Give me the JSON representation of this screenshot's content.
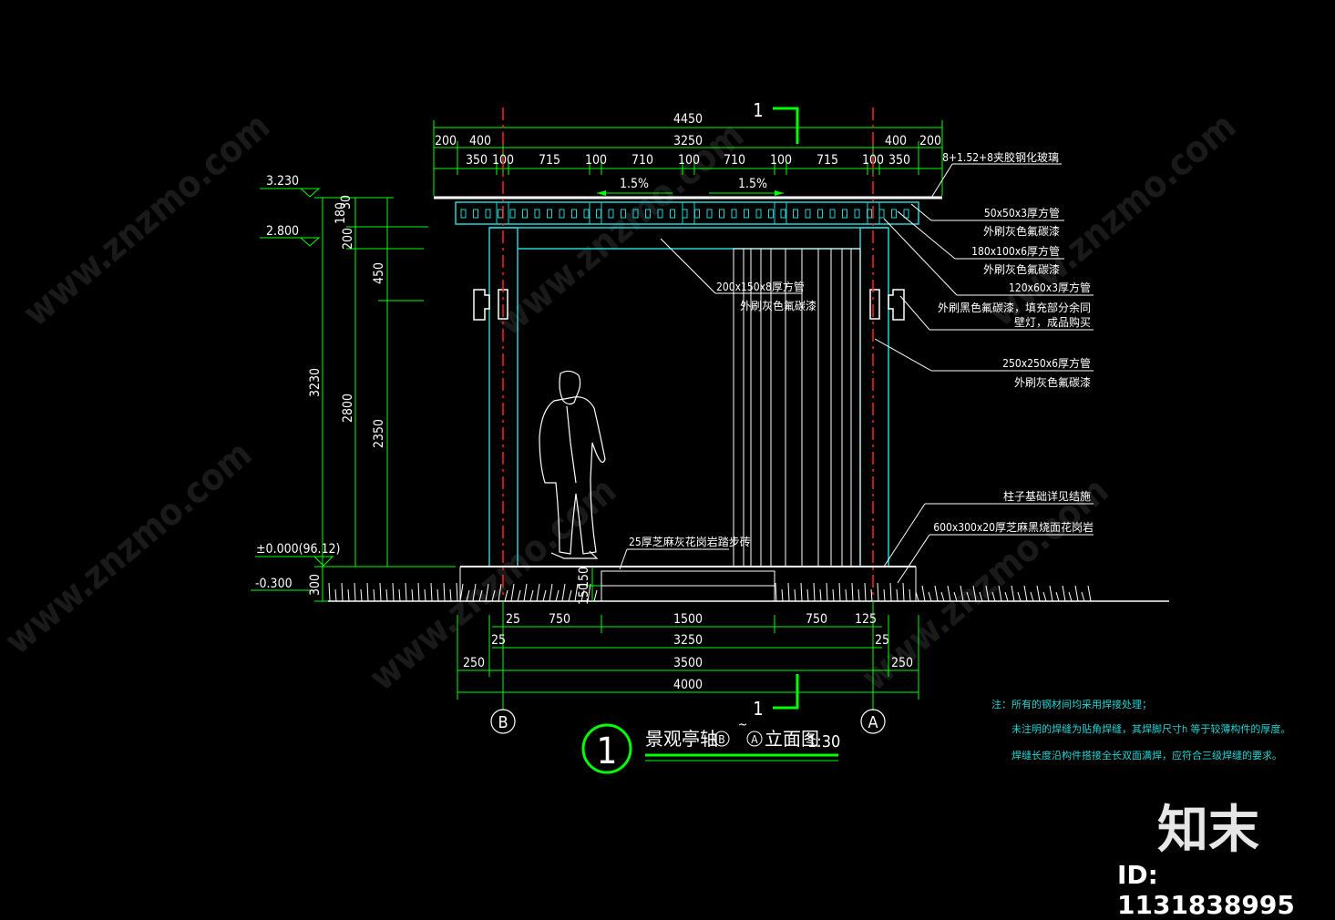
{
  "drawing": {
    "section_mark_top": "1",
    "section_mark_bottom": "1",
    "slope_left": "1.5%",
    "slope_right": "1.5%",
    "top_dims": {
      "overall": "4450",
      "row2": [
        "200",
        "400",
        "3250",
        "400",
        "200"
      ],
      "row3": [
        "350",
        "100",
        "715",
        "100",
        "710",
        "100",
        "710",
        "100",
        "715",
        "100",
        "350"
      ]
    },
    "levels": {
      "top": "3.230",
      "beam": "2.800",
      "ground": "±0.000(96.12)",
      "base": "-0.300"
    },
    "vert_dims": {
      "left_a": [
        "3230",
        "300"
      ],
      "left_b": "2800",
      "left_c": [
        "180",
        "30",
        "200",
        "450",
        "2350"
      ],
      "step": [
        "150",
        "150"
      ]
    },
    "bottom_dims": {
      "row1": [
        "25",
        "750",
        "1500",
        "750",
        "125"
      ],
      "row2": [
        "25",
        "3250",
        "25"
      ],
      "row3": [
        "250",
        "3500",
        "250"
      ],
      "row4": "4000"
    },
    "axes": {
      "left": "B",
      "right": "A"
    },
    "annotations": {
      "glass": "8+1.52+8夹胶钢化玻璃",
      "tube1_a": "50x50x3厚方管",
      "tube1_b": "外刷灰色氟碳漆",
      "tube2_a": "180x100x6厚方管",
      "tube2_b": "外刷灰色氟碳漆",
      "tube3_a": "120x60x3厚方管",
      "tube3_b": "外刷黑色氟碳漆，填充部分余同",
      "tube3_c": "壁灯，成品购买",
      "column_a": "250x250x6厚方管",
      "column_b": "外刷灰色氟碳漆",
      "beam_a": "200x150x8厚方管",
      "beam_b": "外刷灰色氟碳漆",
      "foundation": "柱子基础详见结施",
      "paving": "600x300x20厚芝麻黑烧面花岗岩",
      "step": "25厚芝麻灰花岗岩踏步砖"
    },
    "title": {
      "number": "1",
      "text_a": "景观亭轴",
      "axis_b": "B",
      "tilde": "~",
      "axis_a": "A",
      "text_b": "立面图",
      "scale": "1:30"
    },
    "notes": [
      "注：所有的钢材间均采用焊接处理；",
      "未注明的焊缝为贴角焊缝，其焊脚尺寸h 等于较薄构件的厚度。",
      "焊缝长度沿构件搭接全长双面满焊，应符合三级焊缝的要求。"
    ]
  },
  "watermark": {
    "text": "www.znzmo.com",
    "cn": "知末网",
    "brand": "知末",
    "id": "ID: 1131838995"
  },
  "colors": {
    "background": "#000000",
    "lines": "#ffffff",
    "dimension": "#00ff00",
    "structure": "#22d3d3",
    "axis": "#ff2020",
    "notes": "#22d3d3"
  }
}
